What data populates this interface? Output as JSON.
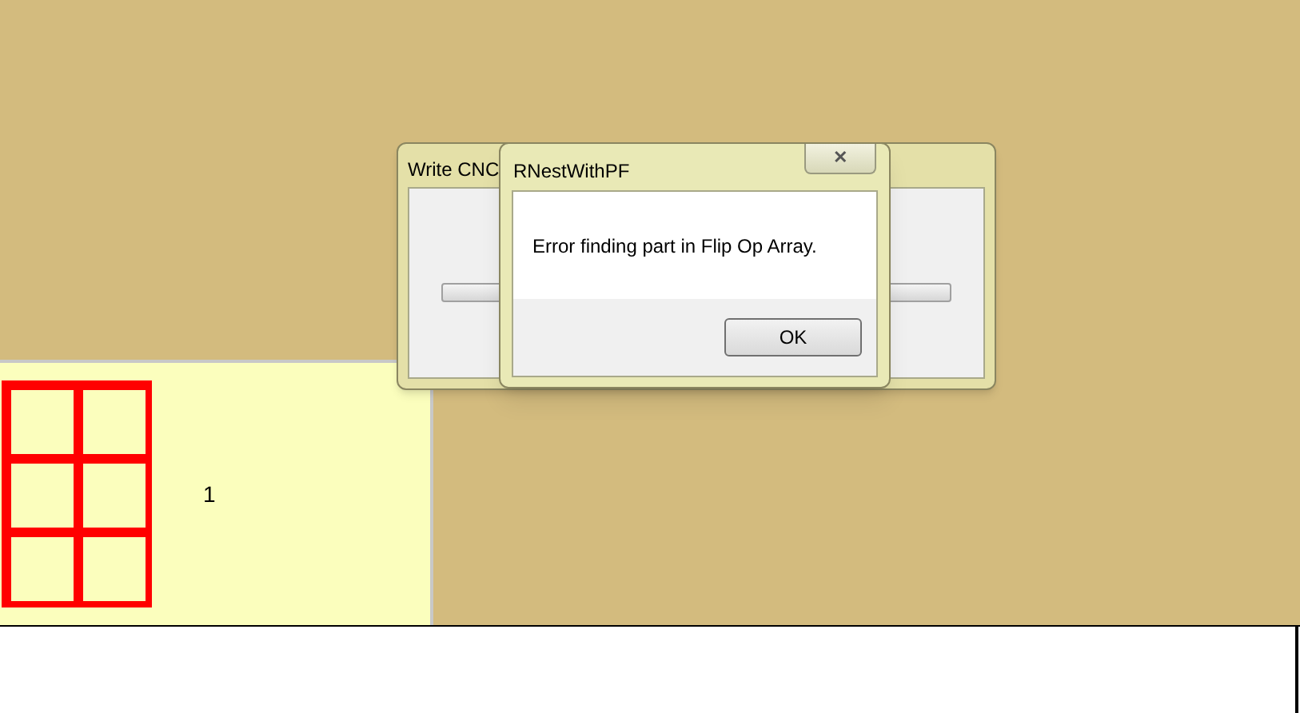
{
  "nest_panel": {
    "label": "1"
  },
  "back_dialog": {
    "title": "Write CNC",
    "progress": {
      "level": 0
    }
  },
  "message_box": {
    "title": "RNestWithPF",
    "close_glyph": "✕",
    "message": "Error finding part in Flip Op Array.",
    "buttons": [
      "OK"
    ]
  }
}
